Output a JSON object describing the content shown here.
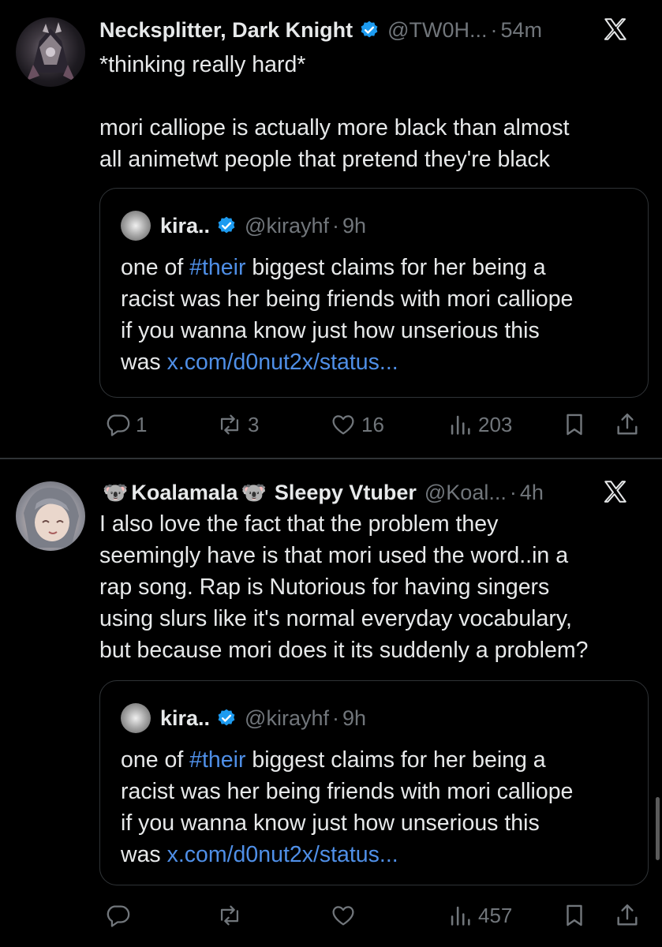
{
  "tweets": [
    {
      "name": "Necksplitter, Dark Knight",
      "handle": "@TW0H...",
      "time": "54m",
      "text_lines": [
        "*thinking really hard*",
        "",
        "mori calliope is actually more black than almost",
        "all animetwt people that pretend they're black"
      ],
      "quote": {
        "name": "kira..",
        "handle": "@kirayhf",
        "time": "9h",
        "line1_pre": "one of ",
        "hashtag": "#their",
        "line1_post": " biggest claims for her being a",
        "line2": "racist was her being friends with mori calliope",
        "line3": "if you wanna know just how unserious this",
        "line4_pre": "was ",
        "link": "x.com/d0nut2x/status..."
      },
      "stats": {
        "replies": "1",
        "reposts": "3",
        "likes": "16",
        "views": "203"
      }
    },
    {
      "name_part1": "Koalamala",
      "name_part2": "Sleepy Vtuber",
      "koala_emoji": "🐨",
      "handle": "@Koal...",
      "time": "4h",
      "text_lines": [
        "I also love the fact that the problem they",
        "seemingly have is that mori used the word..in a",
        "rap song. Rap is Nutorious for having singers",
        "using slurs like it's normal everyday vocabulary,",
        "but because mori does it its suddenly a problem?"
      ],
      "quote": {
        "name": "kira..",
        "handle": "@kirayhf",
        "time": "9h",
        "line1_pre": "one of ",
        "hashtag": "#their",
        "line1_post": " biggest claims for her being a",
        "line2": "racist was her being friends with mori calliope",
        "line3": "if you wanna know just how unserious this",
        "line4_pre": "was ",
        "link": "x.com/d0nut2x/status..."
      },
      "stats": {
        "replies": "",
        "reposts": "",
        "likes": "",
        "views": "457"
      }
    }
  ],
  "separator": "·",
  "colors": {
    "background": "#000000",
    "text": "#e7e9ea",
    "muted": "#71767b",
    "link": "#4f8fe7",
    "verified": "#1d9bf0",
    "border": "#2f3336"
  },
  "icons": [
    "verified-badge-icon",
    "x-logo-icon",
    "reply-icon",
    "repost-icon",
    "like-icon",
    "views-icon",
    "bookmark-icon",
    "share-icon"
  ]
}
